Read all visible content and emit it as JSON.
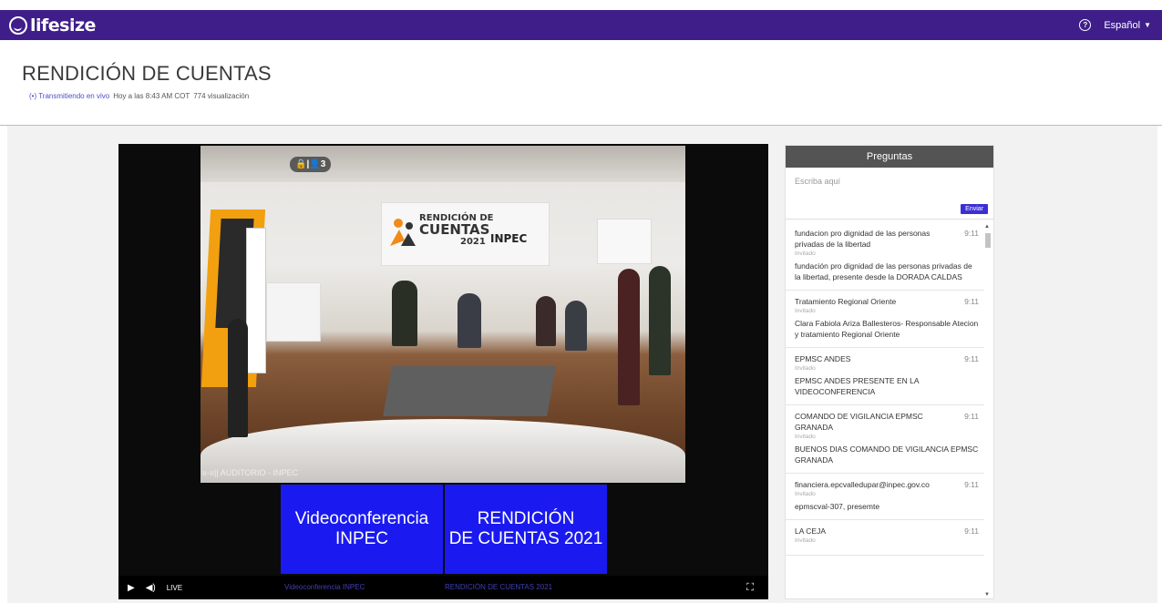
{
  "header": {
    "brand": "lifesize",
    "language": "Español"
  },
  "event": {
    "title": "RENDICIÓN DE CUENTAS",
    "live_status": "Transmitiendo en vivo",
    "date_time": "Hoy a las 8:43 AM COT",
    "views": "774 visualización"
  },
  "video": {
    "participants_badge": "🔒|👤3",
    "camera_label": "AUDITORIO - INPEC",
    "tiles": [
      {
        "line1": "Videoconferencia",
        "line2": "INPEC"
      },
      {
        "line1": "RENDICIÓN",
        "line2": "DE CUENTAS 2021"
      }
    ],
    "controls": {
      "live_label": "LIVE",
      "track1": "Videoconferencia INPEC",
      "track2": "RENDICIÓN DE CUENTAS 2021"
    },
    "banner": {
      "line1": "RENDICIÓN DE",
      "line2": "CUENTAS",
      "org": "INPEC",
      "year": "2021"
    }
  },
  "questions": {
    "title": "Preguntas",
    "input_placeholder": "Escriba aquí",
    "send_label": "Enviar",
    "items": [
      {
        "author": "fundacion pro dignidad de las personas privadas de la libertad",
        "time": "9:11",
        "role": "Invitado",
        "text": "fundación pro dignidad de las personas privadas de la libertad, presente desde la DORADA CALDAS"
      },
      {
        "author": "Tratamiento Regional Oriente",
        "time": "9:11",
        "role": "Invitado",
        "text": "Clara Fabiola Ariza Ballesteros- Responsable Atecion y tratamiento Regional Oriente"
      },
      {
        "author": "EPMSC ANDES",
        "time": "9:11",
        "role": "Invitado",
        "text": "EPMSC ANDES PRESENTE EN LA VIDEOCONFERENCIA"
      },
      {
        "author": "COMANDO DE VIGILANCIA EPMSC GRANADA",
        "time": "9:11",
        "role": "Invitado",
        "text": "BUENOS DIAS COMANDO DE VIGILANCIA EPMSC GRANADA"
      },
      {
        "author": "financiera.epcvalledupar@inpec.gov.co",
        "time": "9:11",
        "role": "Invitado",
        "text": "epmscval-307, presemte"
      },
      {
        "author": "LA CEJA",
        "time": "9:11",
        "role": "Invitado",
        "text": ""
      }
    ]
  }
}
